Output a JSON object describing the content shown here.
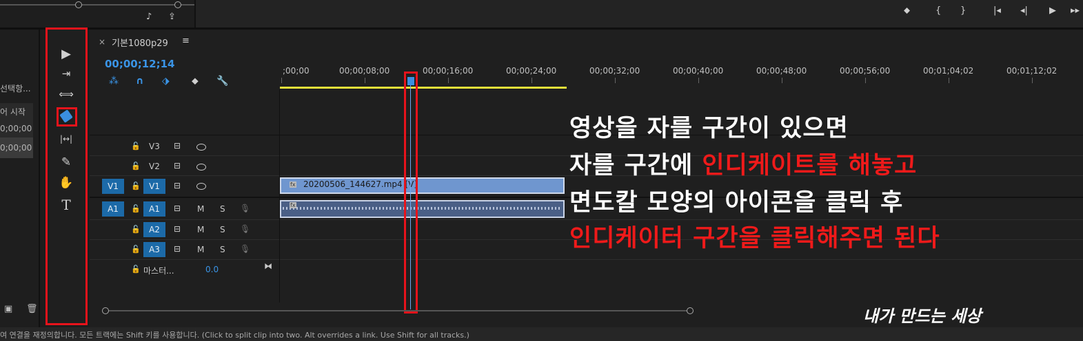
{
  "top": {
    "icons": [
      "♪",
      "⇪"
    ],
    "transport": [
      "⬥",
      "{",
      "}",
      "|◂",
      "◂|",
      "▶",
      "▸▸"
    ]
  },
  "project": {
    "label_1": "선택항...",
    "label_2": "어 시작",
    "tc_1": "0;00;00",
    "tc_2": "0;00;00"
  },
  "tools": {
    "select_icon": "select-arrow-icon",
    "track_select_icon": "track-select-forward-icon",
    "ripple_icon": "ripple-edit-icon",
    "razor_icon": "razor-icon",
    "slip_icon": "slip-icon",
    "pen_icon": "pen-icon",
    "hand_icon": "hand-icon",
    "type_icon": "type-icon",
    "glyph_select": "▶",
    "glyph_track": "⇥",
    "glyph_ripple": "⟺",
    "glyph_slip": "|↔|",
    "glyph_pen": "✎",
    "glyph_hand": "✋",
    "glyph_type": "T"
  },
  "sequence": {
    "close": "×",
    "title": "기본1080p29",
    "menu": "≡",
    "timecode": "00;00;12;14"
  },
  "ruler": {
    "labels": [
      ";00;00",
      "00;00;08;00",
      "00;00;16;00",
      "00;00;24;00",
      "00;00;32;00",
      "00;00;40;00",
      "00;00;48;00",
      "00;00;56;00",
      "00;01;04;02",
      "00;01;12;02"
    ]
  },
  "tracks": {
    "v3": "V3",
    "v2": "V2",
    "v1": "V1",
    "v1_src": "V1",
    "a1": "A1",
    "a1_src": "A1",
    "a2": "A2",
    "a3": "A3",
    "m": "M",
    "s": "S",
    "master": "마스터...",
    "master_value": "0.0"
  },
  "clips": {
    "video": "20200506_144627.mp4 [V]",
    "fx": "fx"
  },
  "caption": {
    "line1": "영상을 자를 구간이 있으면",
    "line2_white": "자를 구간에 ",
    "line2_red": "인디케이트를 해놓고",
    "line3": "면도칼 모양의 아이콘을 클릭 후",
    "line4": "인디케이터 구간을 클릭해주면 된다"
  },
  "watermark": "내가 만드는 세상",
  "status": "여 연결을 재정의합니다. 모든 트랙에는 Shift 키를 사용합니다. (Click to split clip into two. Alt overrides a link. Use Shift for all tracks.)",
  "colors": {
    "accent_blue": "#3a94e6",
    "highlight_red": "#e8131b",
    "work_area_yellow": "#e7e03a"
  }
}
